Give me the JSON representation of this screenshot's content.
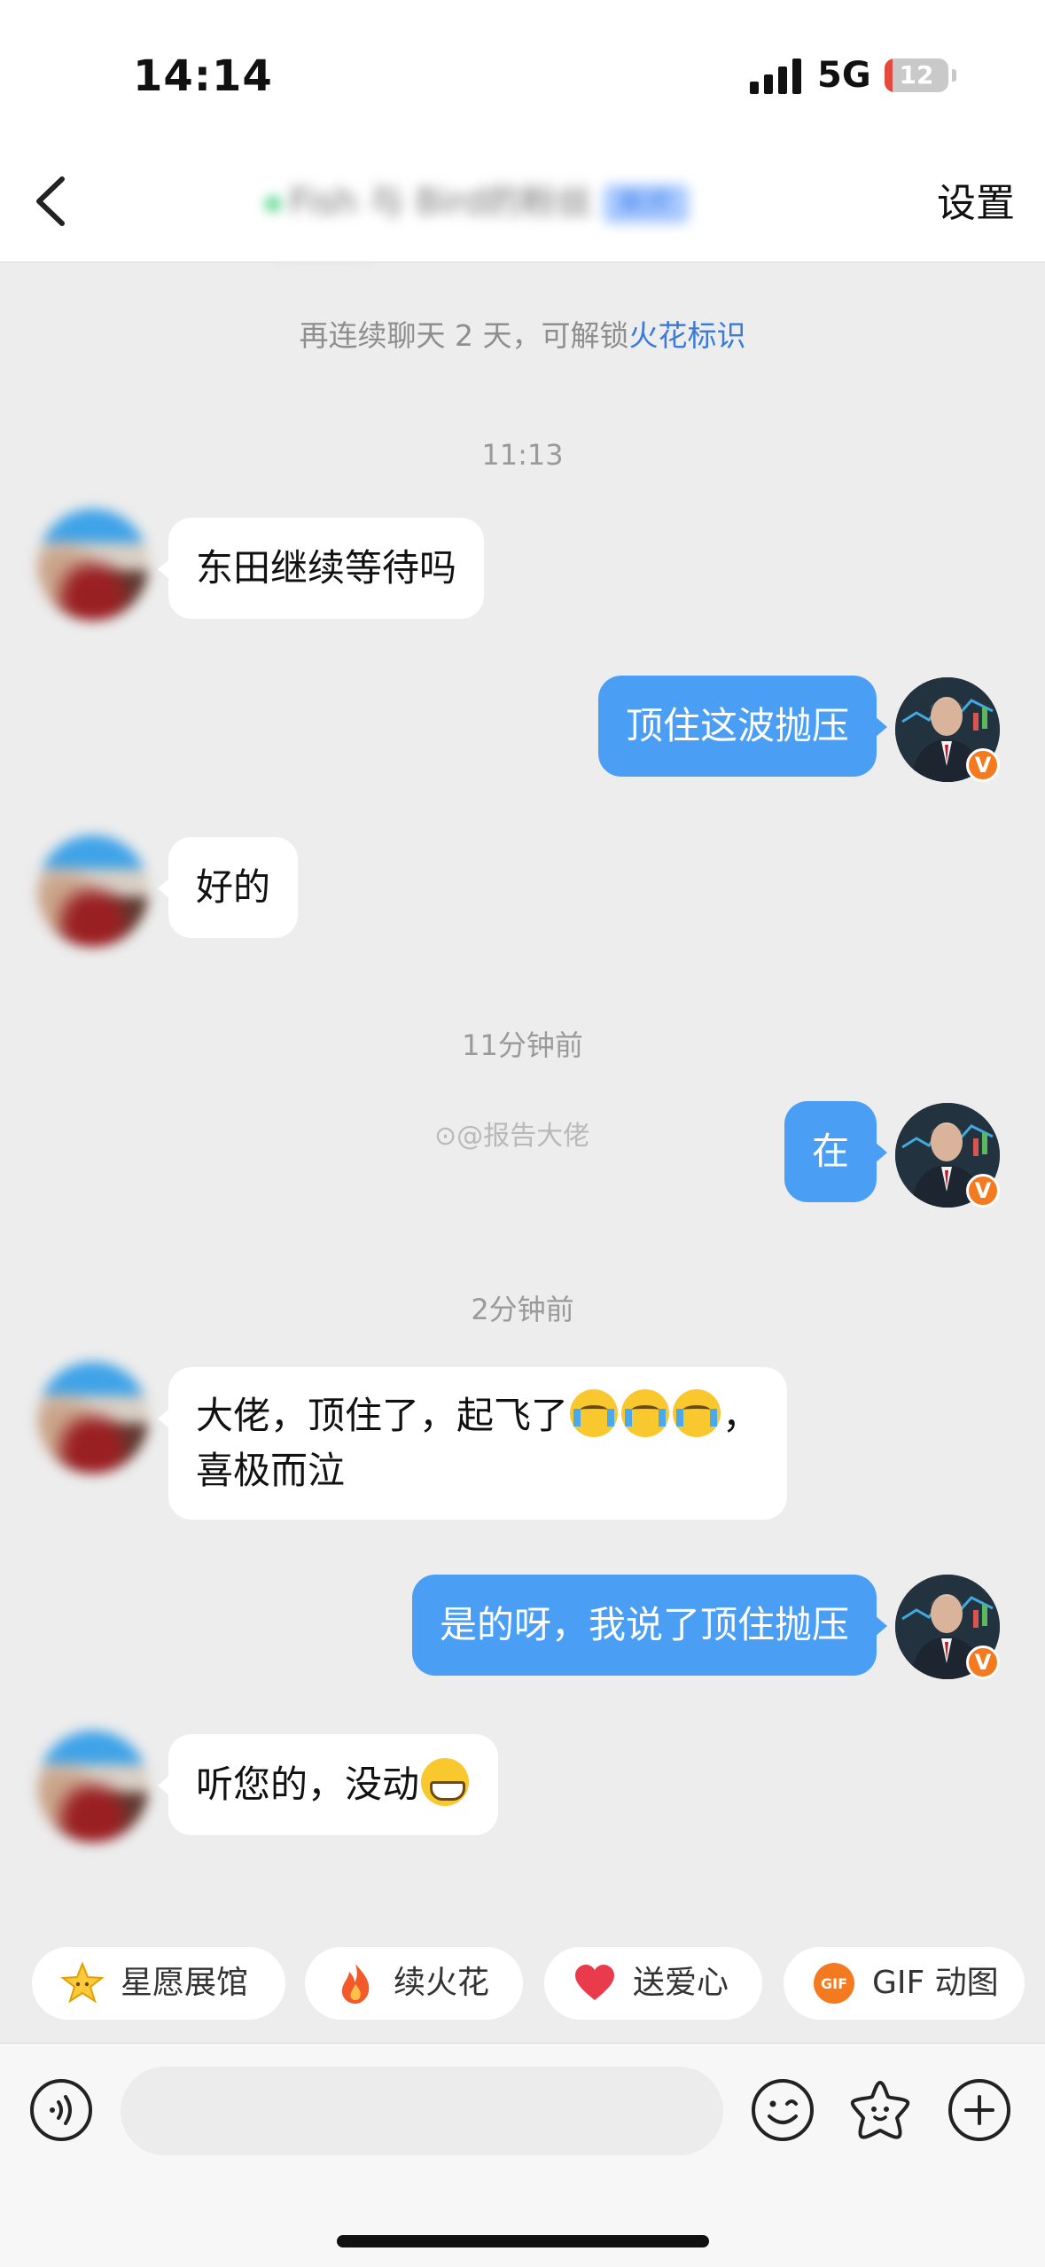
{
  "status_bar": {
    "time": "14:14",
    "network": "5G",
    "battery": "12",
    "battery_level": 0.12
  },
  "nav": {
    "title": "Fish 与 Bird的粉丝",
    "title_tag": "新开",
    "settings_label": "设置"
  },
  "system_note": {
    "text": "再连续聊天 2 天，可解锁",
    "link": "火花标识"
  },
  "messages": [
    {
      "type": "time",
      "text": "11:13"
    },
    {
      "type": "in",
      "text": "东田继续等待吗"
    },
    {
      "type": "out",
      "text": "顶住这波抛压"
    },
    {
      "type": "in",
      "text": "好的"
    },
    {
      "type": "time",
      "text": "11分钟前"
    },
    {
      "type": "out",
      "text": "在"
    },
    {
      "type": "time",
      "text": "2分钟前"
    },
    {
      "type": "in",
      "text_line1": "大佬，顶住了，起飞了",
      "text_line1_end": "，",
      "text_line2": "喜极而泣",
      "emojis": [
        "loudly-crying-face-emoji",
        "loudly-crying-face-emoji",
        "loudly-crying-face-emoji"
      ]
    },
    {
      "type": "out",
      "text": "是的呀，我说了顶住抛压"
    },
    {
      "type": "in",
      "text": "听您的，没动",
      "emojis": [
        "grinning-face-emoji"
      ]
    }
  ],
  "watermark": "@报告大佬",
  "verified_badge": "V",
  "quick_actions": [
    {
      "label": "星愿展馆",
      "icon": "star-face-icon"
    },
    {
      "label": "续火花",
      "icon": "flame-icon"
    },
    {
      "label": "送爱心",
      "icon": "heart-icon"
    },
    {
      "label": "GIF 动图",
      "icon": "gif-icon",
      "icon_text": "GIF"
    }
  ],
  "input": {
    "placeholder": "",
    "value": ""
  },
  "colors": {
    "accent": "#4a9ff5",
    "link": "#3a7ad9",
    "background": "#ededed",
    "badge": "#f47a20"
  }
}
